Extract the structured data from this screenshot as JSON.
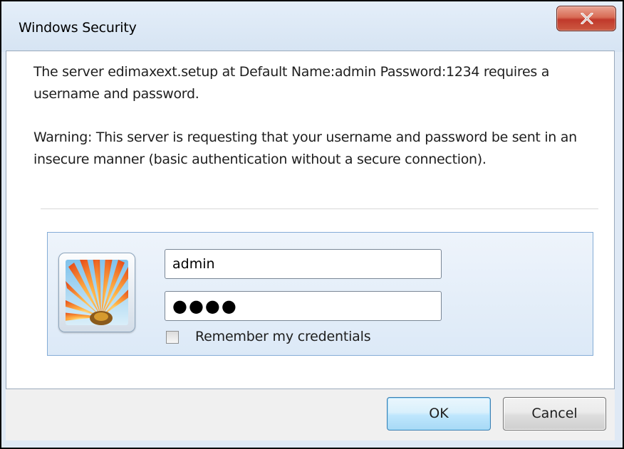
{
  "window": {
    "title": "Windows Security",
    "close_icon": "close-x-icon"
  },
  "message": {
    "line1": "The server edimaxext.setup at Default Name:admin Password:1234 requires a username and password.",
    "warning": "Warning: This server is requesting that your username and password be sent in an insecure manner (basic authentication without a secure connection)."
  },
  "credentials": {
    "avatar_icon": "user-flower-icon",
    "username_value": "admin",
    "password_value": "●●●●",
    "remember_label": "Remember my credentials",
    "remember_checked": false
  },
  "buttons": {
    "ok_label": "OK",
    "cancel_label": "Cancel"
  },
  "colors": {
    "close_button": "#c0392b",
    "ok_button_border": "#3c7fb1",
    "panel_border": "#84acd6"
  }
}
